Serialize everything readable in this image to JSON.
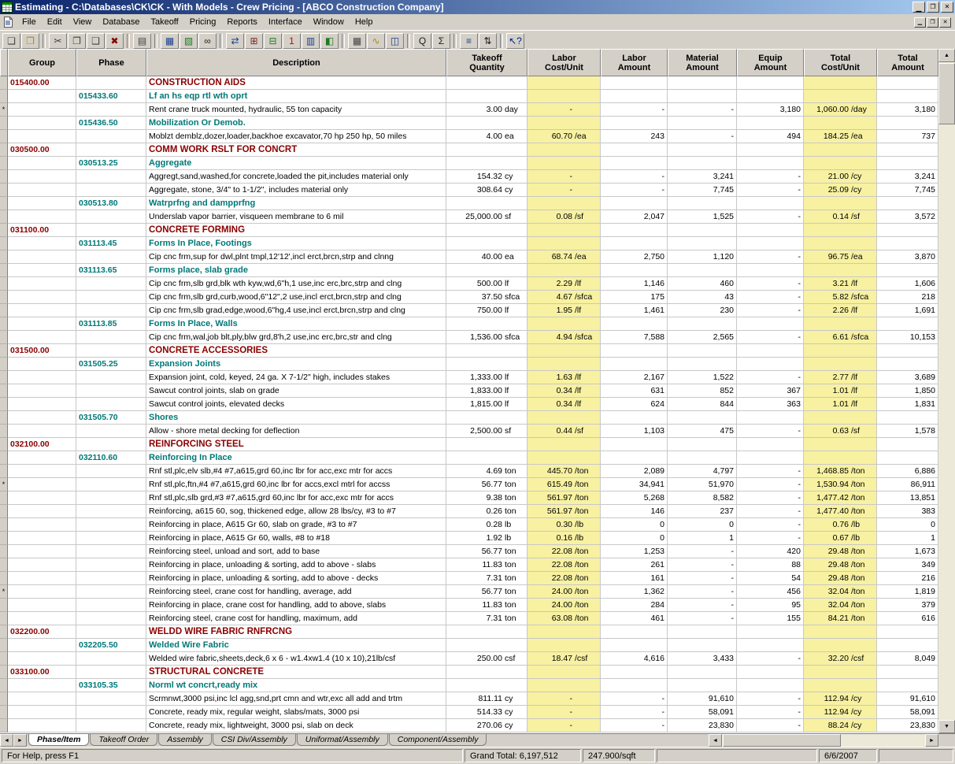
{
  "window": {
    "title": "Estimating - C:\\Databases\\CK\\CK - With Models - Crew Pricing - [ABCO Construction Company]",
    "controls": {
      "minimize": "▁",
      "restore": "❐",
      "close": "✕"
    }
  },
  "icons": {
    "up": "▲",
    "down": "▼",
    "left": "◄",
    "right": "►"
  },
  "menu": {
    "items": [
      "File",
      "Edit",
      "View",
      "Database",
      "Takeoff",
      "Pricing",
      "Reports",
      "Interface",
      "Window",
      "Help"
    ]
  },
  "toolbar": {
    "buttons": [
      {
        "name": "new-button",
        "glyph": "❏",
        "color": "#404040"
      },
      {
        "name": "open-button",
        "glyph": "❒",
        "color": "#b8860b"
      },
      {
        "sep": true
      },
      {
        "name": "cut-button",
        "glyph": "✂",
        "color": "#404040"
      },
      {
        "name": "copy-button",
        "glyph": "❐",
        "color": "#404040"
      },
      {
        "name": "paste-button",
        "glyph": "❑",
        "color": "#404040"
      },
      {
        "name": "delete-button",
        "glyph": "✖",
        "color": "#8b0000"
      },
      {
        "sep": true
      },
      {
        "name": "print-button",
        "glyph": "▤",
        "color": "#404040"
      },
      {
        "sep": true
      },
      {
        "name": "takeoff-button",
        "glyph": "▦",
        "color": "#1a3f8f"
      },
      {
        "name": "quick-takeoff-button",
        "glyph": "▧",
        "color": "#1f7a1f"
      },
      {
        "name": "find-button",
        "glyph": "∞",
        "color": "#202020"
      },
      {
        "sep": true
      },
      {
        "name": "interface-button",
        "glyph": "⇄",
        "color": "#1a3f8f"
      },
      {
        "name": "item-takeoff-button",
        "glyph": "⊞",
        "color": "#7a1f1f"
      },
      {
        "name": "assembly-takeoff-button",
        "glyph": "⊟",
        "color": "#1f7a1f"
      },
      {
        "name": "one-time-item-button",
        "glyph": "1",
        "color": "#cc0000"
      },
      {
        "name": "review-assemblies-button",
        "glyph": "▥",
        "color": "#1a3f8f"
      },
      {
        "name": "chart-button",
        "glyph": "◧",
        "color": "#1f7a1f"
      },
      {
        "sep": true
      },
      {
        "name": "calculator-button",
        "glyph": "▦",
        "color": "#404040"
      },
      {
        "name": "crew-pricing-button",
        "glyph": "∿",
        "color": "#b8860b"
      },
      {
        "name": "spreadsheet-layout-button",
        "glyph": "◫",
        "color": "#1a3f8f"
      },
      {
        "sep": true
      },
      {
        "name": "zoom-button",
        "glyph": "Q",
        "color": "#202020"
      },
      {
        "name": "totals-button",
        "glyph": "Σ",
        "color": "#202020"
      },
      {
        "sep": true
      },
      {
        "name": "detail-button",
        "glyph": "≡",
        "color": "#1a3f8f"
      },
      {
        "name": "sort-button",
        "glyph": "⇅",
        "color": "#202020"
      },
      {
        "sep": true
      },
      {
        "name": "help-button",
        "glyph": "↖?",
        "color": "#00218a"
      }
    ]
  },
  "grid": {
    "columns": [
      {
        "key": "group",
        "label": "Group"
      },
      {
        "key": "phase",
        "label": "Phase"
      },
      {
        "key": "desc",
        "label": "Description"
      },
      {
        "key": "qty",
        "label": "Takeoff\nQuantity"
      },
      {
        "key": "lcu",
        "label": "Labor\nCost/Unit"
      },
      {
        "key": "lam",
        "label": "Labor\nAmount"
      },
      {
        "key": "mam",
        "label": "Material\nAmount"
      },
      {
        "key": "eam",
        "label": "Equip\nAmount"
      },
      {
        "key": "tcu",
        "label": "Total\nCost/Unit"
      },
      {
        "key": "tam",
        "label": "Total\nAmount"
      }
    ],
    "rows": [
      {
        "t": "g",
        "code": "015400.00",
        "desc": "CONSTRUCTION AIDS"
      },
      {
        "t": "p",
        "code": "015433.60",
        "desc": "Lf an hs eqp rtl wth oprt"
      },
      {
        "t": "i",
        "m": "*",
        "desc": "Rent crane truck mounted, hydraulic, 55 ton capacity",
        "qty": "3.00",
        "qu": "day",
        "lcu": "-",
        "lcuu": "",
        "lam": "-",
        "mam": "-",
        "eam": "3,180",
        "tcu": "1,060.00",
        "tcuu": "/day",
        "tam": "3,180"
      },
      {
        "t": "p",
        "code": "015436.50",
        "desc": "Mobilization Or Demob."
      },
      {
        "t": "i",
        "desc": "Moblzt demblz,dozer,loader,backhoe excavator,70 hp 250 hp, 50 miles",
        "qty": "4.00",
        "qu": "ea",
        "lcu": "60.70",
        "lcuu": "/ea",
        "lam": "243",
        "mam": "-",
        "eam": "494",
        "tcu": "184.25",
        "tcuu": "/ea",
        "tam": "737"
      },
      {
        "t": "g",
        "code": "030500.00",
        "desc": "COMM WORK RSLT FOR CONCRT"
      },
      {
        "t": "p",
        "code": "030513.25",
        "desc": "Aggregate"
      },
      {
        "t": "i",
        "desc": "Aggregt,sand,washed,for concrete,loaded the pit,includes material only",
        "qty": "154.32",
        "qu": "cy",
        "lcu": "-",
        "lcuu": "",
        "lam": "-",
        "mam": "3,241",
        "eam": "-",
        "tcu": "21.00",
        "tcuu": "/cy",
        "tam": "3,241"
      },
      {
        "t": "i",
        "desc": "Aggregate, stone, 3/4\" to 1-1/2\", includes material only",
        "qty": "308.64",
        "qu": "cy",
        "lcu": "-",
        "lcuu": "",
        "lam": "-",
        "mam": "7,745",
        "eam": "-",
        "tcu": "25.09",
        "tcuu": "/cy",
        "tam": "7,745"
      },
      {
        "t": "p",
        "code": "030513.80",
        "desc": "Watrprfng and dampprfng"
      },
      {
        "t": "i",
        "desc": "Underslab vapor barrier, visqueen membrane to 6 mil",
        "qty": "25,000.00",
        "qu": "sf",
        "lcu": "0.08",
        "lcuu": "/sf",
        "lam": "2,047",
        "mam": "1,525",
        "eam": "-",
        "tcu": "0.14",
        "tcuu": "/sf",
        "tam": "3,572"
      },
      {
        "t": "g",
        "code": "031100.00",
        "desc": "CONCRETE FORMING"
      },
      {
        "t": "p",
        "code": "031113.45",
        "desc": "Forms In Place, Footings"
      },
      {
        "t": "i",
        "desc": "Cip cnc frm,sup for dwl,plnt tmpl,12'12',incl erct,brcn,strp and clnng",
        "qty": "40.00",
        "qu": "ea",
        "lcu": "68.74",
        "lcuu": "/ea",
        "lam": "2,750",
        "mam": "1,120",
        "eam": "-",
        "tcu": "96.75",
        "tcuu": "/ea",
        "tam": "3,870"
      },
      {
        "t": "p",
        "code": "031113.65",
        "desc": "Forms place, slab grade"
      },
      {
        "t": "i",
        "desc": "Cip cnc frm,slb grd,blk wth kyw,wd,6\"h,1 use,inc erc,brc,strp and clng",
        "qty": "500.00",
        "qu": "lf",
        "lcu": "2.29",
        "lcuu": "/lf",
        "lam": "1,146",
        "mam": "460",
        "eam": "-",
        "tcu": "3.21",
        "tcuu": "/lf",
        "tam": "1,606"
      },
      {
        "t": "i",
        "desc": "Cip cnc frm,slb grd,curb,wood,6\"12\",2 use,incl erct,brcn,strp and clng",
        "qty": "37.50",
        "qu": "sfca",
        "lcu": "4.67",
        "lcuu": "/sfca",
        "lam": "175",
        "mam": "43",
        "eam": "-",
        "tcu": "5.82",
        "tcuu": "/sfca",
        "tam": "218"
      },
      {
        "t": "i",
        "desc": "Cip cnc frm,slb grad,edge,wood,6\"hg,4 use,incl erct,brcn,strp and clng",
        "qty": "750.00",
        "qu": "lf",
        "lcu": "1.95",
        "lcuu": "/lf",
        "lam": "1,461",
        "mam": "230",
        "eam": "-",
        "tcu": "2.26",
        "tcuu": "/lf",
        "tam": "1,691"
      },
      {
        "t": "p",
        "code": "031113.85",
        "desc": "Forms In Place, Walls"
      },
      {
        "t": "i",
        "desc": "Cip cnc frm,wal,job blt,ply,blw grd,8'h,2 use,inc erc,brc,str and clng",
        "qty": "1,536.00",
        "qu": "sfca",
        "lcu": "4.94",
        "lcuu": "/sfca",
        "lam": "7,588",
        "mam": "2,565",
        "eam": "-",
        "tcu": "6.61",
        "tcuu": "/sfca",
        "tam": "10,153"
      },
      {
        "t": "g",
        "code": "031500.00",
        "desc": "CONCRETE ACCESSORIES"
      },
      {
        "t": "p",
        "code": "031505.25",
        "desc": "Expansion Joints"
      },
      {
        "t": "i",
        "desc": "Expansion joint, cold, keyed, 24 ga. X 7-1/2\" high, includes stakes",
        "qty": "1,333.00",
        "qu": "lf",
        "lcu": "1.63",
        "lcuu": "/lf",
        "lam": "2,167",
        "mam": "1,522",
        "eam": "-",
        "tcu": "2.77",
        "tcuu": "/lf",
        "tam": "3,689"
      },
      {
        "t": "i",
        "desc": "Sawcut control joints, slab on grade",
        "qty": "1,833.00",
        "qu": "lf",
        "lcu": "0.34",
        "lcuu": "/lf",
        "lam": "631",
        "mam": "852",
        "eam": "367",
        "tcu": "1.01",
        "tcuu": "/lf",
        "tam": "1,850"
      },
      {
        "t": "i",
        "desc": "Sawcut control joints, elevated decks",
        "qty": "1,815.00",
        "qu": "lf",
        "lcu": "0.34",
        "lcuu": "/lf",
        "lam": "624",
        "mam": "844",
        "eam": "363",
        "tcu": "1.01",
        "tcuu": "/lf",
        "tam": "1,831"
      },
      {
        "t": "p",
        "code": "031505.70",
        "desc": "Shores"
      },
      {
        "t": "i",
        "desc": "Allow - shore metal decking for deflection",
        "qty": "2,500.00",
        "qu": "sf",
        "lcu": "0.44",
        "lcuu": "/sf",
        "lam": "1,103",
        "mam": "475",
        "eam": "-",
        "tcu": "0.63",
        "tcuu": "/sf",
        "tam": "1,578"
      },
      {
        "t": "g",
        "code": "032100.00",
        "desc": "REINFORCING STEEL"
      },
      {
        "t": "p",
        "code": "032110.60",
        "desc": "Reinforcing In Place"
      },
      {
        "t": "i",
        "desc": "Rnf stl,plc,elv slb,#4 #7,a615,grd 60,inc lbr for acc,exc mtr for accs",
        "qty": "4.69",
        "qu": "ton",
        "lcu": "445.70",
        "lcuu": "/ton",
        "lam": "2,089",
        "mam": "4,797",
        "eam": "-",
        "tcu": "1,468.85",
        "tcuu": "/ton",
        "tam": "6,886"
      },
      {
        "t": "i",
        "m": "*",
        "desc": "Rnf stl,plc,ftn,#4 #7,a615,grd 60,inc lbr for accs,excl mtrl for accss",
        "qty": "56.77",
        "qu": "ton",
        "lcu": "615.49",
        "lcuu": "/ton",
        "lam": "34,941",
        "mam": "51,970",
        "eam": "-",
        "tcu": "1,530.94",
        "tcuu": "/ton",
        "tam": "86,911"
      },
      {
        "t": "i",
        "desc": "Rnf stl,plc,slb grd,#3 #7,a615,grd 60,inc lbr for acc,exc mtr for accs",
        "qty": "9.38",
        "qu": "ton",
        "lcu": "561.97",
        "lcuu": "/ton",
        "lam": "5,268",
        "mam": "8,582",
        "eam": "-",
        "tcu": "1,477.42",
        "tcuu": "/ton",
        "tam": "13,851"
      },
      {
        "t": "i",
        "desc": "Reinforcing, a615 60, sog, thickened edge, allow 28 lbs/cy, #3 to #7",
        "qty": "0.26",
        "qu": "ton",
        "lcu": "561.97",
        "lcuu": "/ton",
        "lam": "146",
        "mam": "237",
        "eam": "-",
        "tcu": "1,477.40",
        "tcuu": "/ton",
        "tam": "383"
      },
      {
        "t": "i",
        "desc": "Reinforcing in place, A615 Gr 60, slab on grade, #3 to #7",
        "qty": "0.28",
        "qu": "lb",
        "lcu": "0.30",
        "lcuu": "/lb",
        "lam": "0",
        "mam": "0",
        "eam": "-",
        "tcu": "0.76",
        "tcuu": "/lb",
        "tam": "0"
      },
      {
        "t": "i",
        "desc": "Reinforcing in place, A615 Gr 60, walls, #8 to #18",
        "qty": "1.92",
        "qu": "lb",
        "lcu": "0.16",
        "lcuu": "/lb",
        "lam": "0",
        "mam": "1",
        "eam": "-",
        "tcu": "0.67",
        "tcuu": "/lb",
        "tam": "1"
      },
      {
        "t": "i",
        "desc": "Reinforcing steel, unload and sort, add to base",
        "qty": "56.77",
        "qu": "ton",
        "lcu": "22.08",
        "lcuu": "/ton",
        "lam": "1,253",
        "mam": "-",
        "eam": "420",
        "tcu": "29.48",
        "tcuu": "/ton",
        "tam": "1,673"
      },
      {
        "t": "i",
        "desc": "Reinforcing in place, unloading & sorting, add to above - slabs",
        "qty": "11.83",
        "qu": "ton",
        "lcu": "22.08",
        "lcuu": "/ton",
        "lam": "261",
        "mam": "-",
        "eam": "88",
        "tcu": "29.48",
        "tcuu": "/ton",
        "tam": "349"
      },
      {
        "t": "i",
        "desc": "Reinforcing in place, unloading & sorting, add to above - decks",
        "qty": "7.31",
        "qu": "ton",
        "lcu": "22.08",
        "lcuu": "/ton",
        "lam": "161",
        "mam": "-",
        "eam": "54",
        "tcu": "29.48",
        "tcuu": "/ton",
        "tam": "216"
      },
      {
        "t": "i",
        "m": "*",
        "desc": "Reinforcing steel, crane cost for handling, average, add",
        "qty": "56.77",
        "qu": "ton",
        "lcu": "24.00",
        "lcuu": "/ton",
        "lam": "1,362",
        "mam": "-",
        "eam": "456",
        "tcu": "32.04",
        "tcuu": "/ton",
        "tam": "1,819"
      },
      {
        "t": "i",
        "desc": "Reinforcing in place, crane cost for handling, add to above, slabs",
        "qty": "11.83",
        "qu": "ton",
        "lcu": "24.00",
        "lcuu": "/ton",
        "lam": "284",
        "mam": "-",
        "eam": "95",
        "tcu": "32.04",
        "tcuu": "/ton",
        "tam": "379"
      },
      {
        "t": "i",
        "desc": "Reinforcing steel, crane cost for handling, maximum, add",
        "qty": "7.31",
        "qu": "ton",
        "lcu": "63.08",
        "lcuu": "/ton",
        "lam": "461",
        "mam": "-",
        "eam": "155",
        "tcu": "84.21",
        "tcuu": "/ton",
        "tam": "616"
      },
      {
        "t": "g",
        "code": "032200.00",
        "desc": "WELDD WIRE FABRIC RNFRCNG"
      },
      {
        "t": "p",
        "code": "032205.50",
        "desc": "Welded Wire Fabric"
      },
      {
        "t": "i",
        "desc": "Welded wire fabric,sheets,deck,6 x 6 - w1.4xw1.4 (10 x 10),21lb/csf",
        "qty": "250.00",
        "qu": "csf",
        "lcu": "18.47",
        "lcuu": "/csf",
        "lam": "4,616",
        "mam": "3,433",
        "eam": "-",
        "tcu": "32.20",
        "tcuu": "/csf",
        "tam": "8,049"
      },
      {
        "t": "g",
        "code": "033100.00",
        "desc": "STRUCTURAL CONCRETE"
      },
      {
        "t": "p",
        "code": "033105.35",
        "desc": "Norml wt concrt,ready mix"
      },
      {
        "t": "i",
        "desc": "Scrmnwt,3000 psi,inc lcl agg,snd,prt cmn and wtr,exc all add and trtm",
        "qty": "811.11",
        "qu": "cy",
        "lcu": "-",
        "lcuu": "",
        "lam": "-",
        "mam": "91,610",
        "eam": "-",
        "tcu": "112.94",
        "tcuu": "/cy",
        "tam": "91,610"
      },
      {
        "t": "i",
        "desc": "Concrete, ready mix, regular weight, slabs/mats, 3000 psi",
        "qty": "514.33",
        "qu": "cy",
        "lcu": "-",
        "lcuu": "",
        "lam": "-",
        "mam": "58,091",
        "eam": "-",
        "tcu": "112.94",
        "tcuu": "/cy",
        "tam": "58,091"
      },
      {
        "t": "i",
        "desc": "Concrete, ready mix, lightweight, 3000 psi, slab on deck",
        "qty": "270.06",
        "qu": "cy",
        "lcu": "-",
        "lcuu": "",
        "lam": "-",
        "mam": "23,830",
        "eam": "-",
        "tcu": "88.24",
        "tcuu": "/cy",
        "tam": "23,830"
      }
    ]
  },
  "tabs": {
    "items": [
      {
        "label": "Phase/Item",
        "active": true
      },
      {
        "label": "Takeoff Order",
        "active": false
      },
      {
        "label": "Assembly",
        "active": false
      },
      {
        "label": "CSI Div/Assembly",
        "active": false
      },
      {
        "label": "Uniformat/Assembly",
        "active": false
      },
      {
        "label": "Component/Assembly",
        "active": false
      }
    ]
  },
  "statusbar": {
    "help": "For Help, press F1",
    "grand_total": "Grand Total: 6,197,512",
    "per_sqft": "247.900/sqft",
    "date": "6/6/2007"
  },
  "colors": {
    "highlight": "#f7f1a1",
    "group_text": "#8b0000",
    "phase_text": "#007878",
    "titlebar_start": "#0a246a",
    "titlebar_end": "#a6caf0"
  }
}
